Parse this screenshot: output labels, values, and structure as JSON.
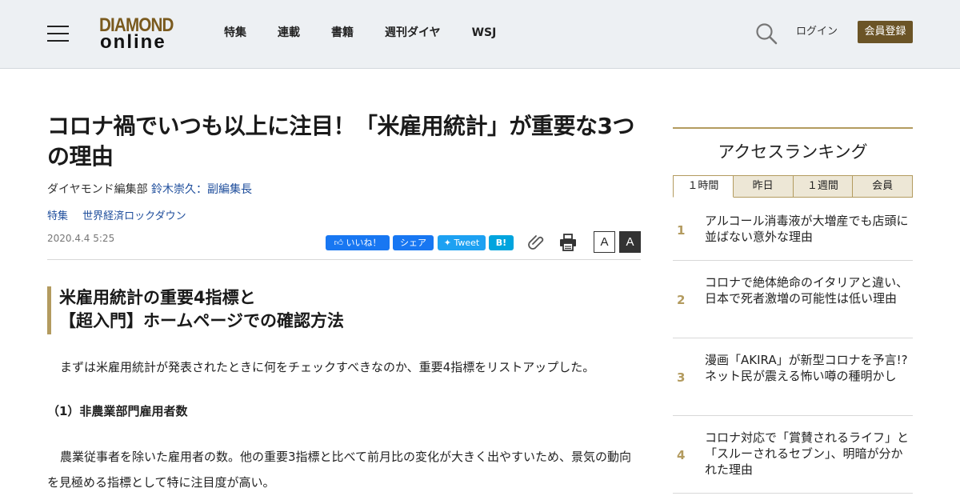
{
  "header": {
    "logo_top": "DIAMOND",
    "logo_bottom": "online",
    "nav": [
      "特集",
      "連載",
      "書籍",
      "週刊ダイヤ",
      "WSJ"
    ],
    "login": "ログイン",
    "register": "会員登録",
    "colors": {
      "background": "#edf0f3",
      "register_button": "#6b5426",
      "logo_gold": "#7a5a1e"
    }
  },
  "article": {
    "title": "コロナ禍でいつも以上に注目！「米雇用統計」が重要な3つの理由",
    "byline_prefix": "ダイヤモンド編集部 ",
    "author": "鈴木崇久：副編集長",
    "tags": [
      "特集",
      "世界経済ロックダウン"
    ],
    "date": "2020.4.4 5:25",
    "share": {
      "like": "いいね！",
      "share": "シェア",
      "tweet": "Tweet",
      "hatena": "B!"
    },
    "font_size_buttons": [
      "A",
      "A"
    ],
    "heading_line1": "米雇用統計の重要4指標と",
    "heading_line2": "【超入門】ホームページでの確認方法",
    "paragraph1": "まずは米雇用統計が発表されたときに何をチェックすべきなのか、重要4指標をリストアップした。",
    "subheading": "（1）非農業部門雇用者数",
    "paragraph2": "農業従事者を除いた雇用者の数。他の重要3指標と比べて前月比の変化が大きく出やすいため、景気の動向を見極める指標として特に注目度が高い。"
  },
  "sidebar": {
    "title": "アクセスランキング",
    "tabs": [
      "１時間",
      "昨日",
      "１週間",
      "会員"
    ],
    "rankings": [
      {
        "rank": "1",
        "text": "アルコール消毒液が大増産でも店頭に並ばない意外な理由"
      },
      {
        "rank": "2",
        "text": "コロナで絶体絶命のイタリアと違い、日本で死者激増の可能性は低い理由"
      },
      {
        "rank": "3",
        "text": "漫画「AKIRA」が新型コロナを予言!?ネット民が震える怖い噂の種明かし"
      },
      {
        "rank": "4",
        "text": "コロナ対応で「賞賛されるライフ」と「スルーされるセブン」、明暗が分かれた理由"
      }
    ],
    "accent_color": "#b39b5f"
  }
}
